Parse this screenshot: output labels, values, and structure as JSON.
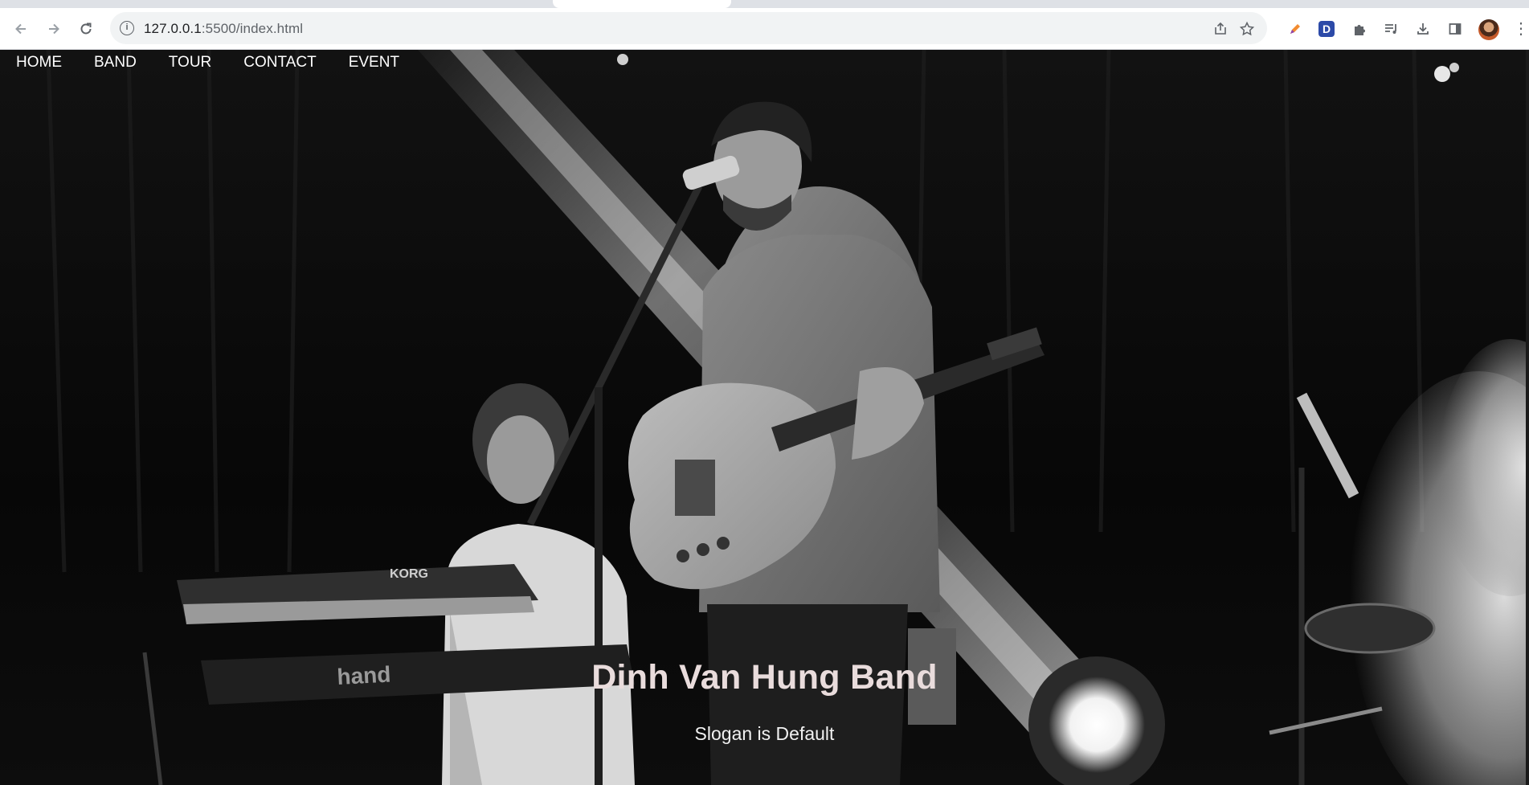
{
  "browser": {
    "url_host": "127.0.0.1",
    "url_rest": ":5500/index.html",
    "icons": {
      "back": "arrow-left-icon",
      "forward": "arrow-right-icon",
      "reload": "reload-icon",
      "info": "info-icon",
      "share": "share-icon",
      "bookmark": "star-icon",
      "extensions": [
        "pen-extension-icon",
        "d-extension-icon",
        "puzzle-icon",
        "media-queue-icon",
        "download-icon",
        "side-panel-icon"
      ],
      "menu": "kebab-menu-icon"
    },
    "d_extension_label": "D"
  },
  "nav": {
    "items": [
      {
        "label": "HOME"
      },
      {
        "label": "BAND"
      },
      {
        "label": "TOUR"
      },
      {
        "label": "CONTACT"
      },
      {
        "label": "EVENT"
      }
    ]
  },
  "hero": {
    "title": "Dinh Van Hung Band",
    "slogan": "Slogan is Default",
    "colors": {
      "title": "#e9dcdc",
      "slogan": "#f1f1f1",
      "background": "#050505"
    }
  }
}
